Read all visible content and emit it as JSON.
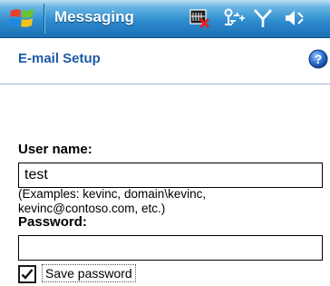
{
  "titlebar": {
    "title": "Messaging",
    "icons": [
      "windows-start-icon",
      "notification-icon",
      "connectivity-icon",
      "signal-icon",
      "volume-icon"
    ]
  },
  "header": {
    "title": "E-mail Setup",
    "help_icon": "help-icon"
  },
  "form": {
    "username_label": "User name:",
    "username_value": "test",
    "username_hint_line1": "(Examples: kevinc, domain\\kevinc,",
    "username_hint_line2": "kevinc@contoso.com, etc.)",
    "password_label": "Password:",
    "password_value": "",
    "save_password_label": "Save password",
    "save_password_checked": true
  },
  "colors": {
    "titlebar_top": "#6ab7e3",
    "titlebar_bottom": "#1a6fb4",
    "header_text": "#1c5aa6",
    "help_icon": "#2a6fd0"
  }
}
